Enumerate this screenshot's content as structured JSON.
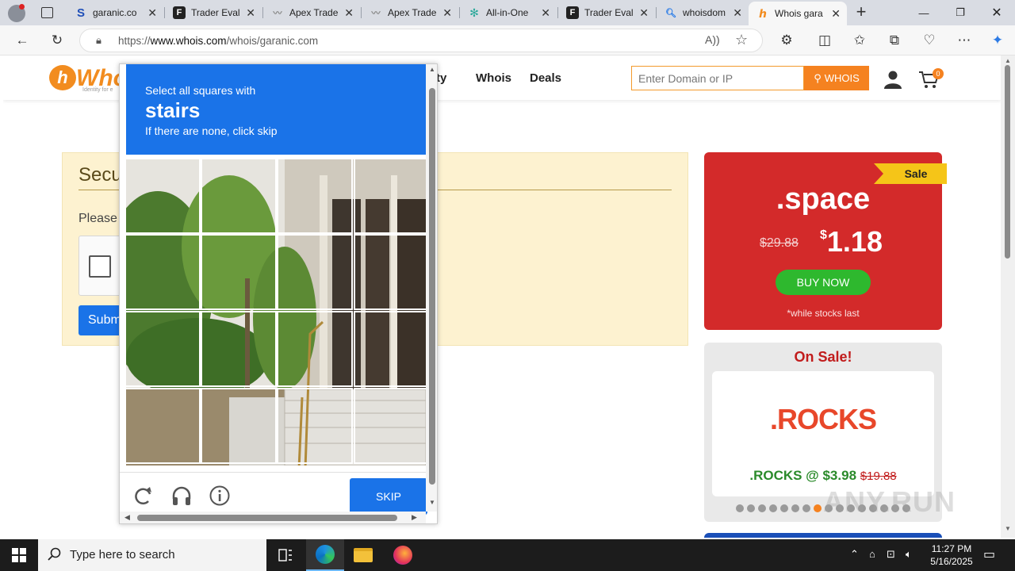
{
  "browser": {
    "tabs": [
      {
        "title": "garanic.co",
        "favicon": "s-logo-icon",
        "color": "#1f4fb8",
        "active": false
      },
      {
        "title": "Trader Eval",
        "favicon": "f-logo-icon",
        "color": "#222222",
        "active": false
      },
      {
        "title": "Apex Trade",
        "favicon": "apex-icon",
        "color": "#8a8a8a",
        "active": false
      },
      {
        "title": "Apex Trade",
        "favicon": "apex-icon",
        "color": "#8a8a8a",
        "active": false
      },
      {
        "title": "All-in-One",
        "favicon": "aio-icon",
        "color": "#2aa89a",
        "active": false
      },
      {
        "title": "Trader Eval",
        "favicon": "f-logo-icon",
        "color": "#222222",
        "active": false
      },
      {
        "title": "whoisdom",
        "favicon": "search-icon",
        "color": "#1a73e8",
        "active": false
      },
      {
        "title": "Whois gara",
        "favicon": "whois-icon",
        "color": "#f28c1f",
        "active": true
      }
    ],
    "url_prefix": "https://",
    "url_host": "www.whois.com",
    "url_path": "/whois/garanic.com"
  },
  "site": {
    "logo_text": "Who",
    "logo_tag": "Identity for e",
    "nav": [
      "rity",
      "Whois",
      "Deals"
    ],
    "search_placeholder": "Enter Domain or IP",
    "search_button": "WHOIS",
    "cart_count": "0"
  },
  "security": {
    "title": "Secu",
    "text": "Please",
    "submit": "Subm"
  },
  "captcha": {
    "line1": "Select all squares with",
    "keyword": "stairs",
    "line2": "If there are none, click skip",
    "skip": "SKIP"
  },
  "sale": {
    "ribbon": "Sale",
    "tld": ".space",
    "old_price": "$29.88",
    "new_price_symbol": "$",
    "new_price": "1.18",
    "buy": "BUY NOW",
    "note": "*while stocks last"
  },
  "onsale": {
    "title": "On Sale!",
    "logo": ".ROCKS",
    "offer": ".ROCKS @ $3.98",
    "offer_old": "$19.88",
    "dots_total": 16,
    "dots_active": 7
  },
  "taskbar": {
    "search_placeholder": "Type here to search",
    "time": "11:27 PM",
    "date": "5/16/2025"
  },
  "watermark": "ANY.RUN",
  "colors": {
    "accent": "#1a73e8",
    "brand_orange": "#f58220",
    "sale_red": "#d32a2a"
  }
}
